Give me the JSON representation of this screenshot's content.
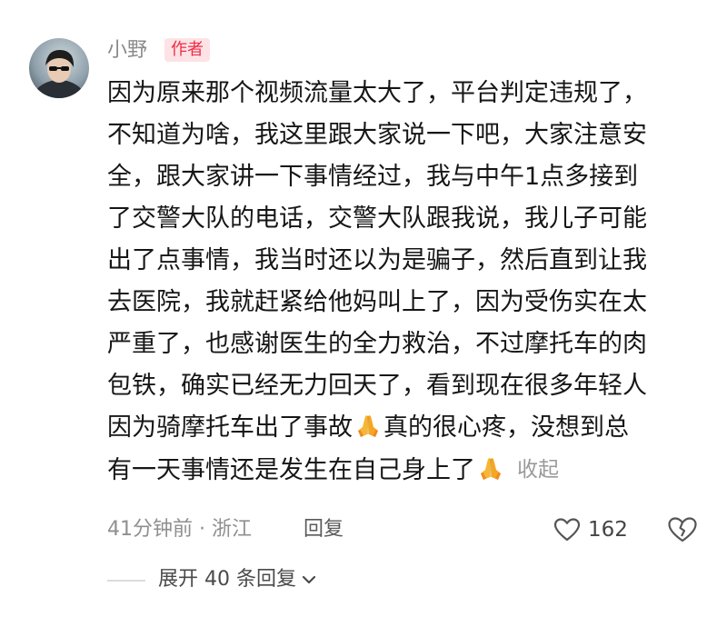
{
  "user": {
    "name": "小野",
    "badge": "作者"
  },
  "comment": {
    "lines": [
      "因为原来那个视频流量太大了，平台判定违规了，",
      "不知道为啥，我这里跟大家说一下吧，大家注意安",
      "全，跟大家讲一下事情经过，我与中午1点多接到",
      "了交警大队的电话，交警大队跟我说，我儿子可能",
      "出了点事情，我当时还以为是骗子，然后直到让我",
      "去医院，我就赶紧给他妈叫上了，因为受伤实在太",
      "严重了，也感谢医生的全力救治，不过摩托车的肉",
      "包铁，确实已经无力回天了，看到现在很多年轻人"
    ],
    "line9_a": "因为骑摩托车出了事故",
    "line9_b": "真的很心疼，没想到总",
    "line10": "有一天事情还是发生在自己身上了",
    "collapse_label": "收起"
  },
  "meta": {
    "time_location": "41分钟前 · 浙江",
    "reply_label": "回复",
    "like_count": "162"
  },
  "expand": {
    "label": "展开 40 条回复"
  },
  "icons": {
    "pray": "folded-hands-icon",
    "like": "heart-outline-icon",
    "dislike": "broken-heart-icon",
    "expand": "chevron-down-icon"
  },
  "colors": {
    "badge_text": "#f02d45",
    "badge_bg": "#fde3e5",
    "meta_text": "#8f8f8f"
  }
}
